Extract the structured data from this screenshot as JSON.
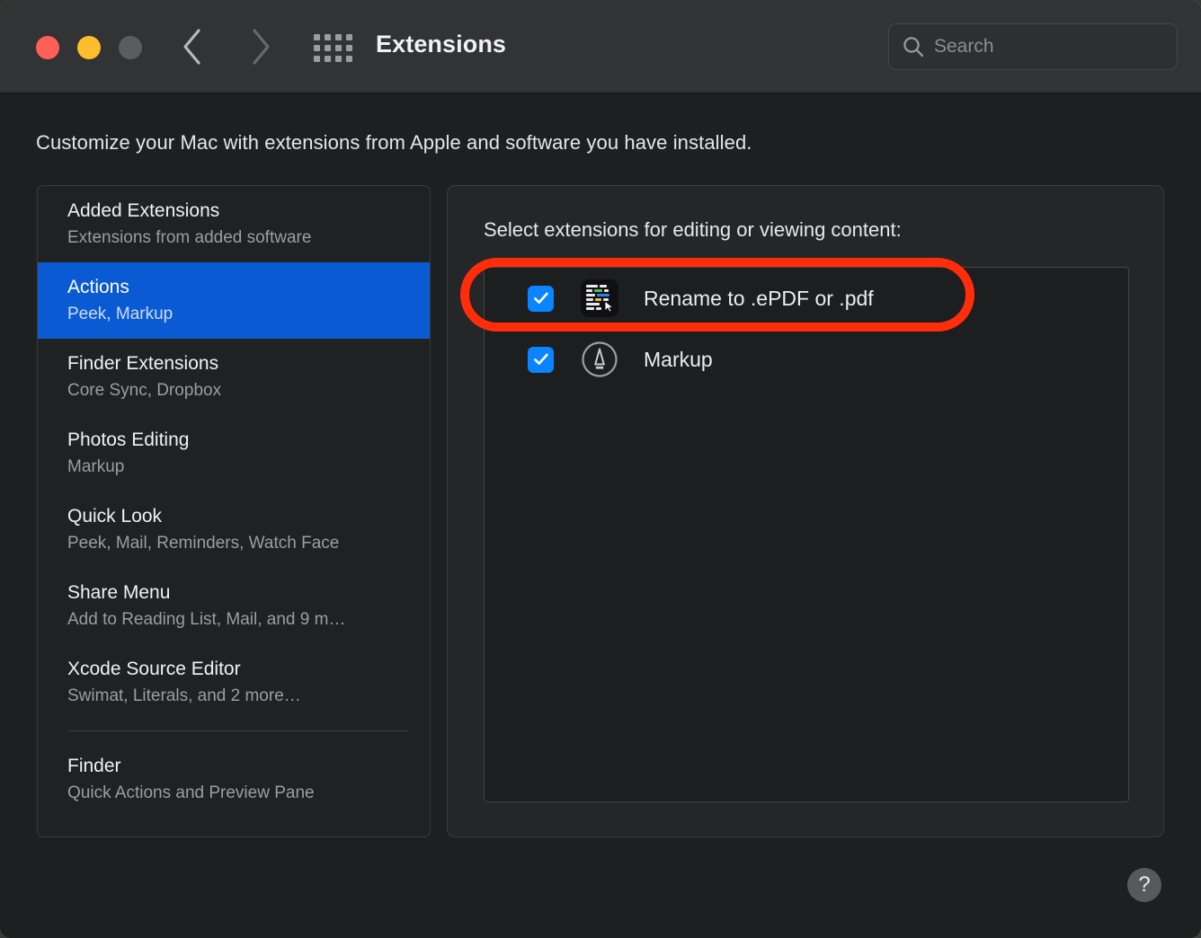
{
  "window": {
    "title": "Extensions",
    "traffic_lights": [
      "close",
      "minimize",
      "zoom"
    ],
    "accent_color": "#0a5bd3",
    "checkbox_color": "#0a84ff",
    "annotation_color": "#ff2d0a"
  },
  "toolbar": {
    "back_label": "Back",
    "forward_label": "Forward",
    "show_all_label": "Show All",
    "search": {
      "value": "",
      "placeholder": "Search"
    }
  },
  "main": {
    "intro": "Customize your Mac with extensions from Apple and software you have installed.",
    "sidebar": {
      "items": [
        {
          "title": "Added Extensions",
          "subtitle": "Extensions from added software",
          "selected": false
        },
        {
          "title": "Actions",
          "subtitle": "Peek, Markup",
          "selected": true
        },
        {
          "title": "Finder Extensions",
          "subtitle": "Core Sync, Dropbox",
          "selected": false
        },
        {
          "title": "Photos Editing",
          "subtitle": "Markup",
          "selected": false
        },
        {
          "title": "Quick Look",
          "subtitle": "Peek, Mail, Reminders, Watch Face",
          "selected": false
        },
        {
          "title": "Share Menu",
          "subtitle": "Add to Reading List, Mail, and 9 m…",
          "selected": false
        },
        {
          "title": "Xcode Source Editor",
          "subtitle": "Swimat, Literals, and 2 more…",
          "selected": false
        }
      ],
      "footer_items": [
        {
          "title": "Finder",
          "subtitle": "Quick Actions and Preview Pane",
          "selected": false
        }
      ]
    },
    "panel": {
      "heading": "Select extensions for editing or viewing content:",
      "extensions": [
        {
          "label": "Rename to .ePDF or .pdf",
          "checked": true,
          "icon": "epdf-document-icon",
          "highlighted": true
        },
        {
          "label": "Markup",
          "checked": true,
          "icon": "markup-pen-icon",
          "highlighted": false
        }
      ]
    },
    "help_label": "?"
  }
}
